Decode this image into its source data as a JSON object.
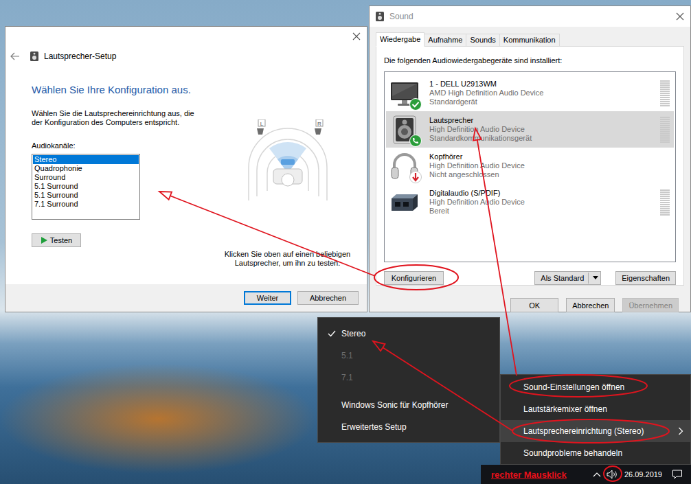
{
  "setup_window": {
    "title": "Lautsprecher-Setup",
    "heading": "Wählen Sie Ihre Konfiguration aus.",
    "description_lines": [
      "Wählen Sie die Lautsprechereinrichtung aus, die",
      "der Konfiguration des Computers entspricht."
    ],
    "channels_label": "Audiokanäle:",
    "channels": [
      {
        "label": "Stereo",
        "selected": true
      },
      {
        "label": "Quadrophonie",
        "selected": false
      },
      {
        "label": "Surround",
        "selected": false
      },
      {
        "label": "5.1 Surround",
        "selected": false
      },
      {
        "label": "5.1 Surround",
        "selected": false
      },
      {
        "label": "7.1 Surround",
        "selected": false
      }
    ],
    "test_button": "Testen",
    "speakers": [
      {
        "label": "L"
      },
      {
        "label": "R"
      }
    ],
    "hint_lines": [
      "Klicken Sie oben auf einen beliebigen",
      "Lautsprecher, um ihn zu testen."
    ],
    "buttons": [
      {
        "label": "Weiter",
        "default": true
      },
      {
        "label": "Abbrechen",
        "default": false
      }
    ]
  },
  "sound_window": {
    "title": "Sound",
    "tabs": [
      {
        "label": "Wiedergabe",
        "selected": true
      },
      {
        "label": "Aufnahme",
        "selected": false
      },
      {
        "label": "Sounds",
        "selected": false
      },
      {
        "label": "Kommunikation",
        "selected": false
      }
    ],
    "intro": "Die folgenden Audiowiedergabegeräte sind installiert:",
    "devices": [
      {
        "name": "1 - DELL U2913WM",
        "driver": "AMD High Definition Audio Device",
        "status": "Standardgerät",
        "kind": "monitor",
        "badge": "check",
        "selected": false,
        "meter": true,
        "level": 0
      },
      {
        "name": "Lautsprecher",
        "driver": "High Definition Audio Device",
        "status": "Standardkommunikationsgerät",
        "kind": "speaker",
        "badge": "phone",
        "selected": true,
        "meter": true,
        "level": 0
      },
      {
        "name": "Kopfhörer",
        "driver": "High Definition Audio Device",
        "status": "Nicht angeschlossen",
        "kind": "headphones",
        "badge": "unplugged",
        "selected": false,
        "meter": false,
        "level": 0
      },
      {
        "name": "Digitalaudio (S/PDIF)",
        "driver": "High Definition Audio Device",
        "status": "Bereit",
        "kind": "spdif",
        "badge": "none",
        "selected": false,
        "meter": true,
        "level": 0
      }
    ],
    "configure_button": "Konfigurieren",
    "set_default_button": "Als Standard",
    "properties_button": "Eigenschaften",
    "buttons": [
      {
        "label": "OK",
        "disabled": false
      },
      {
        "label": "Abbrechen",
        "disabled": false
      },
      {
        "label": "Übernehmen",
        "disabled": true
      }
    ]
  },
  "speaker_setup_menu": {
    "items": [
      {
        "label": "Stereo",
        "checked": true,
        "disabled": false
      },
      {
        "label": "5.1",
        "checked": false,
        "disabled": true
      },
      {
        "label": "7.1",
        "checked": false,
        "disabled": true
      }
    ],
    "extra_items": [
      {
        "label": "Windows Sonic für Kopfhörer"
      },
      {
        "label": "Erweitertes Setup"
      }
    ]
  },
  "tray_menu": {
    "items": [
      {
        "label": "Sound-Einstellungen öffnen",
        "selected": false,
        "submenu": false
      },
      {
        "label": "Lautstärkemixer öffnen",
        "selected": false,
        "submenu": false
      },
      {
        "label": "Lautsprechereinrichtung (Stereo)",
        "selected": true,
        "submenu": true
      },
      {
        "label": "Soundprobleme behandeln",
        "selected": false,
        "submenu": false
      }
    ]
  },
  "taskbar": {
    "date": "26.09.2019"
  },
  "annotation": {
    "label": "rechter Mausklick"
  }
}
